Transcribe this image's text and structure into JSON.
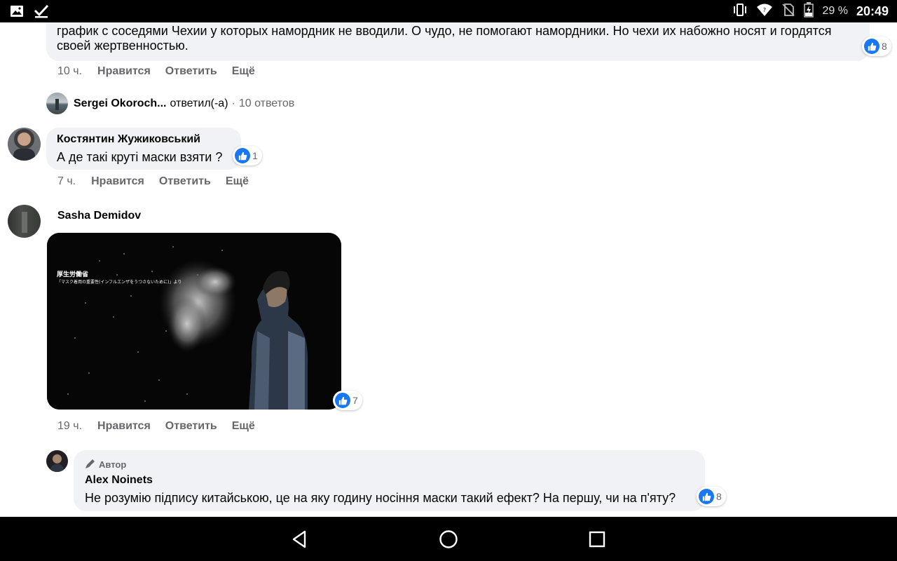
{
  "status_bar": {
    "battery_percent": "29 %",
    "time": "20:49",
    "left_icons": [
      "image-icon",
      "check-icon"
    ],
    "right_icons": [
      "vibrate-icon",
      "wifi-icon",
      "no-sim-icon",
      "battery-icon"
    ]
  },
  "comments": [
    {
      "text_partial": "график с соседями Чехии у которых намордник не вводили. О чудо, не помогают намордники. Но чехи их набожно носят и гордятся своей жертвенностью.",
      "reaction_count": "8",
      "time": "10 ч.",
      "like": "Нравится",
      "reply": "Ответить",
      "more": "Ещё",
      "replies_summary": {
        "name": "Sergei Okoroch...",
        "verb": "ответил(-а)",
        "separator": "·",
        "count": "10 ответов"
      }
    },
    {
      "author": "Костянтин Жужиковський",
      "text": "А де такі круті маски взяти ?",
      "reaction_count": "1",
      "time": "7 ч.",
      "like": "Нравится",
      "reply": "Ответить",
      "more": "Ещё"
    },
    {
      "author": "Sasha Demidov",
      "media_caption_line1": "厚生労働省",
      "media_caption_line2": "「マスク着用の重要性(インフルエンザをうつさないために)」より",
      "reaction_count": "7",
      "time": "19 ч.",
      "like": "Нравится",
      "reply": "Ответить",
      "more": "Ещё"
    },
    {
      "badge": "Автор",
      "author": "Alex Noinets",
      "text": "Не розумію підпису китайською, це на яку годину носіння маски такий ефект? На першу, чи на п'яту?",
      "reaction_count": "8"
    }
  ],
  "nav": {
    "back": "back-icon",
    "home": "home-icon",
    "recents": "recents-icon"
  },
  "colors": {
    "bubble": "#f0f2f5",
    "like_blue": "#1877f2",
    "meta_grey": "#65676b"
  }
}
